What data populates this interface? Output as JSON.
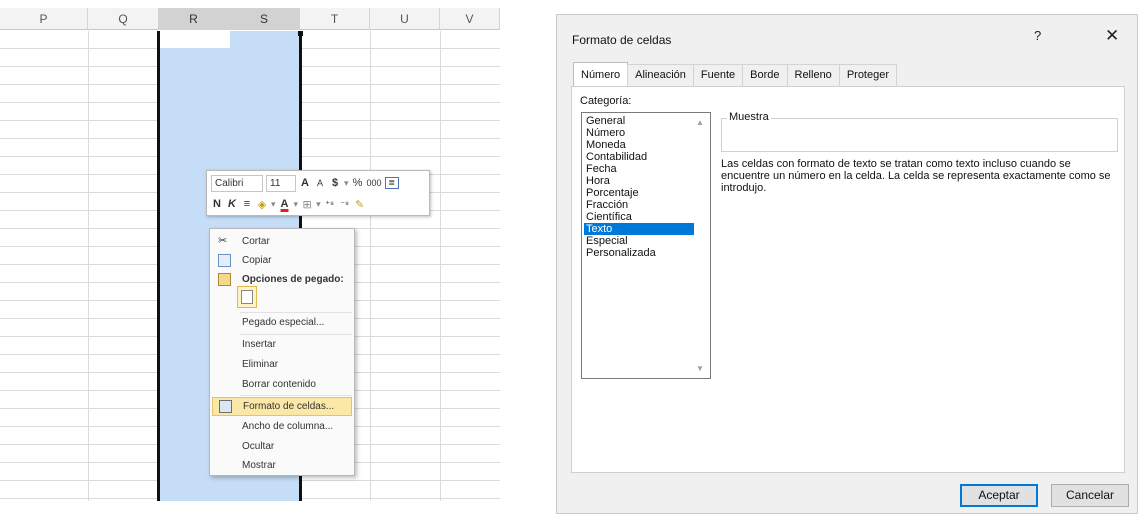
{
  "sheet": {
    "columns": [
      "P",
      "Q",
      "R",
      "S",
      "T",
      "U",
      "V"
    ],
    "selected_columns": [
      "R",
      "S"
    ]
  },
  "minibar": {
    "font_name": "Calibri",
    "font_size": "11",
    "grow_font": "A",
    "shrink_font": "A",
    "currency": "$",
    "percent": "%",
    "thousands": "000",
    "bold": "N",
    "italic": "K",
    "merge_glyph": "≡",
    "font_color": "A",
    "borders_glyph": "⊞",
    "increase_decimals": "⁺⁸",
    "decrease_decimals": "⁻⁸"
  },
  "context_menu": {
    "cut": "Cortar",
    "copy": "Copiar",
    "paste_options": "Opciones de pegado:",
    "paste_special": "Pegado especial...",
    "insert": "Insertar",
    "delete": "Eliminar",
    "clear_contents": "Borrar contenido",
    "format_cells": "Formato de celdas...",
    "column_width": "Ancho de columna...",
    "hide": "Ocultar",
    "show": "Mostrar"
  },
  "dialog": {
    "title": "Formato de celdas",
    "help": "?",
    "close": "✕",
    "tabs": [
      "Número",
      "Alineación",
      "Fuente",
      "Borde",
      "Relleno",
      "Proteger"
    ],
    "active_tab": "Número",
    "category_label": "Categoría:",
    "categories": [
      "General",
      "Número",
      "Moneda",
      "Contabilidad",
      "Fecha",
      "Hora",
      "Porcentaje",
      "Fracción",
      "Científica",
      "Texto",
      "Especial",
      "Personalizada"
    ],
    "selected_category": "Texto",
    "sample_label": "Muestra",
    "description": "Las celdas con formato de texto se tratan como texto incluso cuando se encuentre un número en la celda. La celda se representa exactamente como se introdujo.",
    "ok": "Aceptar",
    "cancel": "Cancelar"
  },
  "colors": {
    "selection_fill": "#c5ddf6",
    "menu_highlight": "#fbe7a6",
    "list_selection": "#0078d7"
  }
}
